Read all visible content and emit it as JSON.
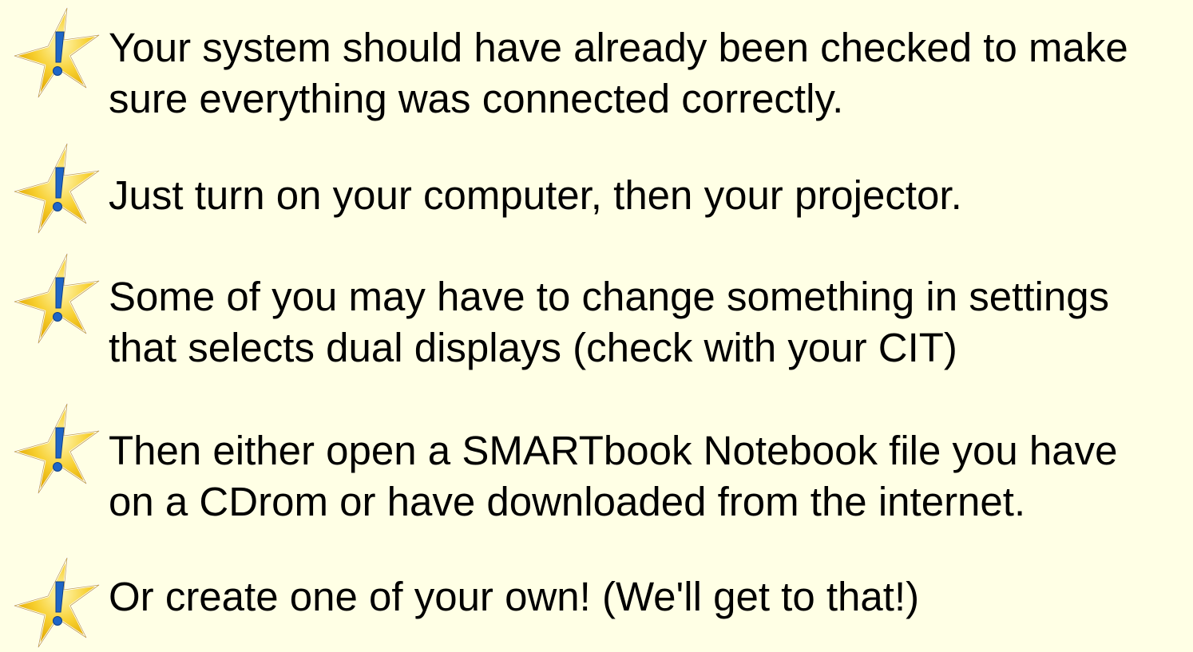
{
  "colors": {
    "background": "#ffffe5",
    "star_fill": "#f5c518",
    "exclamation": "#1f66c7"
  },
  "bullets": [
    {
      "icon": "star-exclamation-icon",
      "lines": [
        "Your system should have already been checked to make",
        "sure everything was connected correctly."
      ]
    },
    {
      "icon": "star-exclamation-icon",
      "lines": [
        "Just turn on your computer, then your projector."
      ]
    },
    {
      "icon": "star-exclamation-icon",
      "lines": [
        "Some of you may have to change something in settings",
        "that selects dual displays (check with your CIT)"
      ]
    },
    {
      "icon": "star-exclamation-icon",
      "lines": [
        "Then either open a SMARTbook Notebook file you have",
        "on a CDrom or have downloaded from the internet."
      ]
    },
    {
      "icon": "star-exclamation-icon",
      "lines": [
        "Or create one of your own! (We'll get to that!)"
      ]
    }
  ]
}
